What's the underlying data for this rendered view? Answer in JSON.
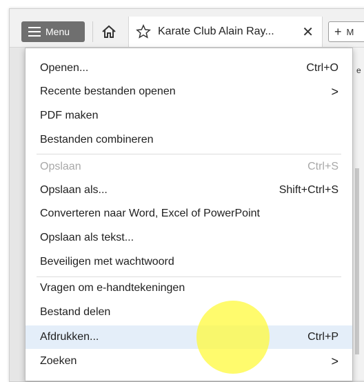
{
  "toolbar": {
    "menu_label": "Menu",
    "tab_title": "Karate Club Alain Ray...",
    "new_tab_trunc": "M"
  },
  "menu": {
    "items": [
      {
        "label": "Openen...",
        "shortcut": "Ctrl+O",
        "submenu": false,
        "disabled": false
      },
      {
        "label": "Recente bestanden openen",
        "shortcut": "",
        "submenu": true,
        "disabled": false
      },
      {
        "label": "PDF maken",
        "shortcut": "",
        "submenu": false,
        "disabled": false
      },
      {
        "label": "Bestanden combineren",
        "shortcut": "",
        "submenu": false,
        "disabled": false
      },
      {
        "label": "Opslaan",
        "shortcut": "Ctrl+S",
        "submenu": false,
        "disabled": true
      },
      {
        "label": "Opslaan als...",
        "shortcut": "Shift+Ctrl+S",
        "submenu": false,
        "disabled": false
      },
      {
        "label": "Converteren naar Word, Excel of PowerPoint",
        "shortcut": "",
        "submenu": false,
        "disabled": false
      },
      {
        "label": "Opslaan als tekst...",
        "shortcut": "",
        "submenu": false,
        "disabled": false
      },
      {
        "label": "Beveiligen met wachtwoord",
        "shortcut": "",
        "submenu": false,
        "disabled": false
      },
      {
        "label": "Vragen om e-handtekeningen",
        "shortcut": "",
        "submenu": false,
        "disabled": false
      },
      {
        "label": "Bestand delen",
        "shortcut": "",
        "submenu": false,
        "disabled": false
      },
      {
        "label": "Afdrukken...",
        "shortcut": "Ctrl+P",
        "submenu": false,
        "disabled": false,
        "highlighted": true
      },
      {
        "label": "Zoeken",
        "shortcut": "",
        "submenu": true,
        "disabled": false
      }
    ],
    "submenu_glyph": ">",
    "background_peek": "e"
  },
  "colors": {
    "menu_button_bg": "#6f6f6f",
    "highlight_row": "#e4eef9",
    "cursor_spot": "#fffa3c"
  }
}
